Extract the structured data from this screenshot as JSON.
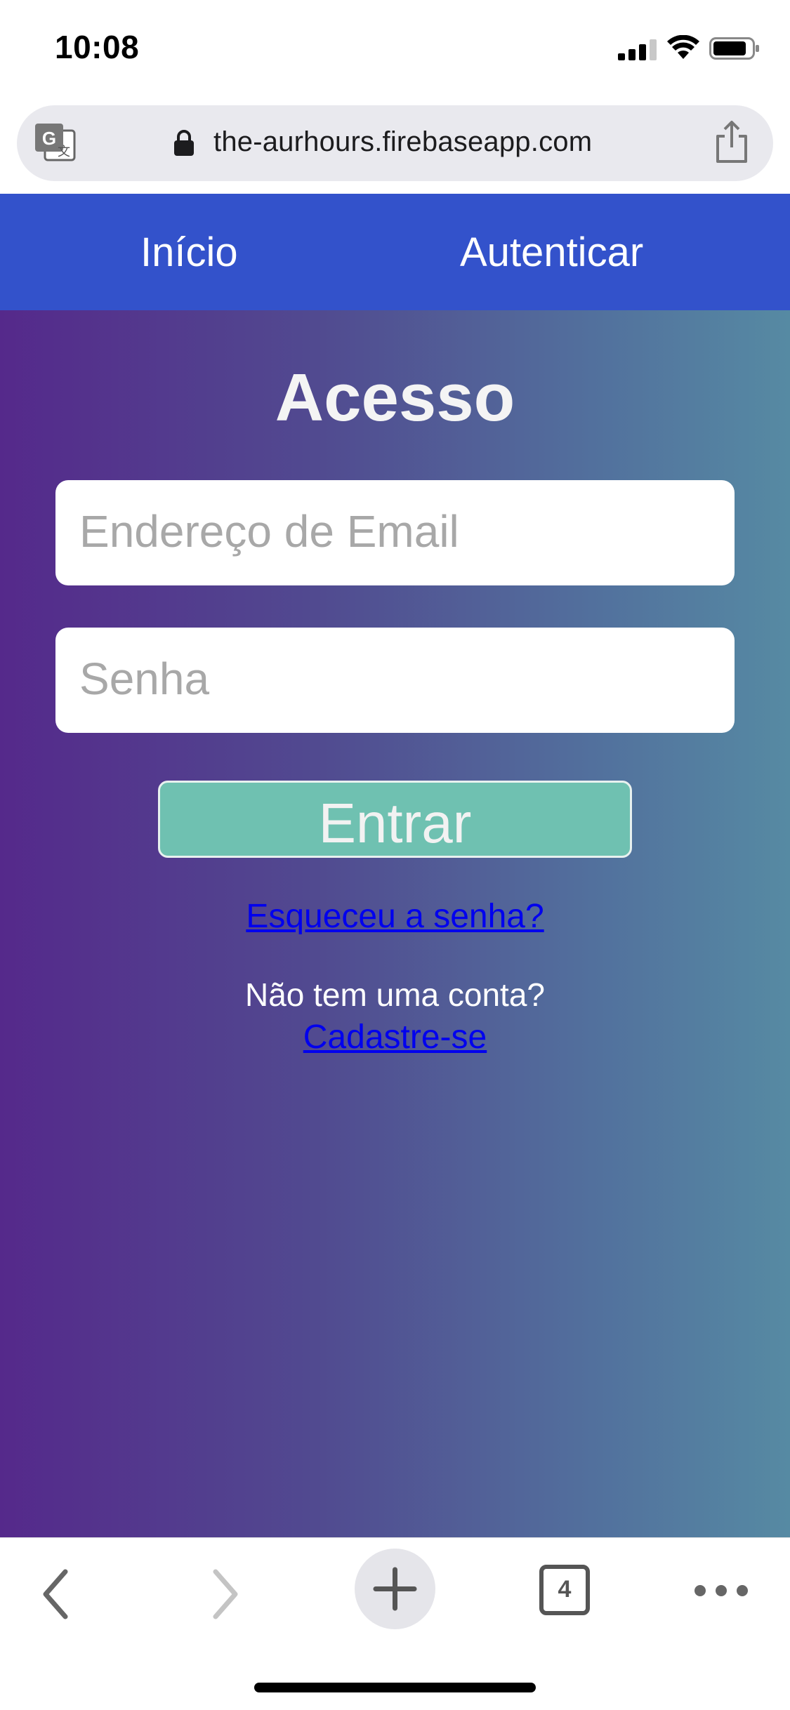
{
  "status_bar": {
    "time": "10:08"
  },
  "browser": {
    "url": "the-aurhours.firebaseapp.com",
    "icons": {
      "translate": "google-translate-icon",
      "lock": "lock-icon",
      "share": "share-icon"
    }
  },
  "nav": {
    "items": [
      {
        "label": "Início"
      },
      {
        "label": "Autenticar"
      }
    ],
    "color": "#3352cb"
  },
  "login": {
    "title": "Acesso",
    "email_placeholder": "Endereço de Email",
    "password_placeholder": "Senha",
    "submit_label": "Entrar",
    "forgot_label": "Esqueceu a senha?",
    "no_account_text": "Não tem uma conta?",
    "signup_label": "Cadastre-se",
    "button_color": "#6fc1b1",
    "gradient": [
      "#55298b",
      "#568aa3"
    ]
  },
  "toolbar": {
    "tabs_count": "4",
    "icons": [
      "back-icon",
      "forward-icon",
      "new-tab-icon",
      "tabs-icon",
      "more-icon"
    ]
  }
}
